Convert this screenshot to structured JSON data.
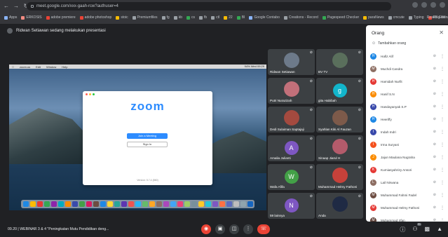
{
  "browser": {
    "url": "meet.google.com/xxx-gaah-rcw?authuser=4",
    "bookmarks": [
      {
        "label": "Apps",
        "color": "#8ab4f8"
      },
      {
        "label": "ERKOSIS",
        "color": "#f28b82"
      },
      {
        "label": "adobe premiere",
        "color": "#ea4335"
      },
      {
        "label": "adobe photoshop",
        "color": "#ea4335"
      },
      {
        "label": "stoic",
        "color": "#fbbc04"
      },
      {
        "label": "Premiumfiles",
        "color": "#9aa0a6"
      },
      {
        "label": "fg",
        "color": "#9aa0a6"
      },
      {
        "label": "kb",
        "color": "#9aa0a6"
      },
      {
        "label": "cs",
        "color": "#34a853"
      },
      {
        "label": "fb",
        "color": "#9aa0a6"
      },
      {
        "label": "ctl",
        "color": "#9aa0a6"
      },
      {
        "label": "22",
        "color": "#fbbc04"
      },
      {
        "label": "BI",
        "color": "#34a853"
      },
      {
        "label": "Google Contabo",
        "color": "#8ab4f8"
      },
      {
        "label": "Creations - Record",
        "color": "#9aa0a6"
      },
      {
        "label": "Pagespeed Checker",
        "color": "#34a853"
      },
      {
        "label": "paraNews",
        "color": "#fbbc04"
      },
      {
        "label": "cmcute",
        "color": "#9aa0a6"
      },
      {
        "label": "Typing",
        "color": "#9aa0a6"
      },
      {
        "label": "RS Editing",
        "color": "#ea4335"
      }
    ],
    "reading_list": "Reading list"
  },
  "banner": {
    "text": "Ridwan Setiawan sedang melakukan presentasi"
  },
  "shared_screen": {
    "mac_menus": [
      "zoom.us",
      "Edit",
      "Window",
      "Help"
    ],
    "mac_status": "94% Wed 09:29",
    "zoom_logo": "zoom",
    "join_label": "Join a Meeting",
    "signin_label": "Sign In",
    "version": "Version: 5.7.4 (860)"
  },
  "tiles": [
    {
      "name": "Ridwan Setiawan",
      "color": "#5f6368",
      "initial": "",
      "photo": "#6d7a8a"
    },
    {
      "name": "BV TV",
      "color": "#5f6368",
      "initial": "",
      "photo": "#5a6f5c"
    },
    {
      "name": "Putri Nurazizah",
      "color": "#5f6368",
      "initial": "",
      "photo": "#c2707a"
    },
    {
      "name": "gita Habibah",
      "color": "#12b5cb",
      "initial": "g",
      "photo": ""
    },
    {
      "name": "Dedi Sulaiman Saptajaji",
      "color": "#5f6368",
      "initial": "",
      "photo": "#a44a3f"
    },
    {
      "name": "Syahlan Kiki Al Fauzan",
      "color": "#5f6368",
      "initial": "",
      "photo": "#7d5a4a"
    },
    {
      "name": "Amalia Julianti",
      "color": "#7e57c2",
      "initial": "A",
      "photo": ""
    },
    {
      "name": "Sinaap Jiarul H",
      "color": "#5f6368",
      "initial": "",
      "photo": "#b45b6b"
    },
    {
      "name": "Wafa Afifa",
      "color": "#43a047",
      "initial": "W",
      "photo": ""
    },
    {
      "name": "Muhammad Helmy Fathoni",
      "color": "#5f6368",
      "initial": "",
      "photo": "#c7413a"
    },
    {
      "name": "59 lainnya",
      "color": "#7e57c2",
      "initial": "N",
      "photo": ""
    },
    {
      "name": "Anda",
      "color": "#5f6368",
      "initial": "",
      "photo": "#1f2a44"
    }
  ],
  "panel": {
    "title": "Orang",
    "subtitle": "Tambahkan orang",
    "participants": [
      {
        "name": "Hafiz Alif",
        "color": "#1e88e5",
        "initial": "H"
      },
      {
        "name": "Muchdi Candra",
        "color": "#8d6e63",
        "initial": "M"
      },
      {
        "name": "Hamidah Nurfit",
        "color": "#e53935",
        "initial": "H"
      },
      {
        "name": "Hanif S.N",
        "color": "#fb8c00",
        "initial": "H"
      },
      {
        "name": "Handayanyak S.P",
        "color": "#3949ab",
        "initial": "H"
      },
      {
        "name": "Heeriffy",
        "color": "#1e88e5",
        "initial": "H"
      },
      {
        "name": "Indah Indri",
        "color": "#3949ab",
        "initial": "I"
      },
      {
        "name": "Irma Suryani",
        "color": "#f4511e",
        "initial": "I"
      },
      {
        "name": "Jajun Maulana Nugraha",
        "color": "#fb8c00",
        "initial": "J"
      },
      {
        "name": "Kurniasyahrizy Ansori",
        "color": "#e53935",
        "initial": "K"
      },
      {
        "name": "Lail Nirwana",
        "color": "#8d6e63",
        "initial": "L"
      },
      {
        "name": "Muhammad Fahmi Fadel",
        "color": "#6d4c41",
        "initial": "M"
      },
      {
        "name": "Muhammad Helmy Fathoni",
        "color": "#e53935",
        "initial": "M"
      },
      {
        "name": "Muhammad Irfan",
        "color": "#5d4037",
        "initial": "M"
      }
    ]
  },
  "bottom": {
    "meeting": "09.20 | WEBINAR 3 & 4 \"Peningkatan Mutu Pendidikan deng...",
    "people_count": "70"
  }
}
